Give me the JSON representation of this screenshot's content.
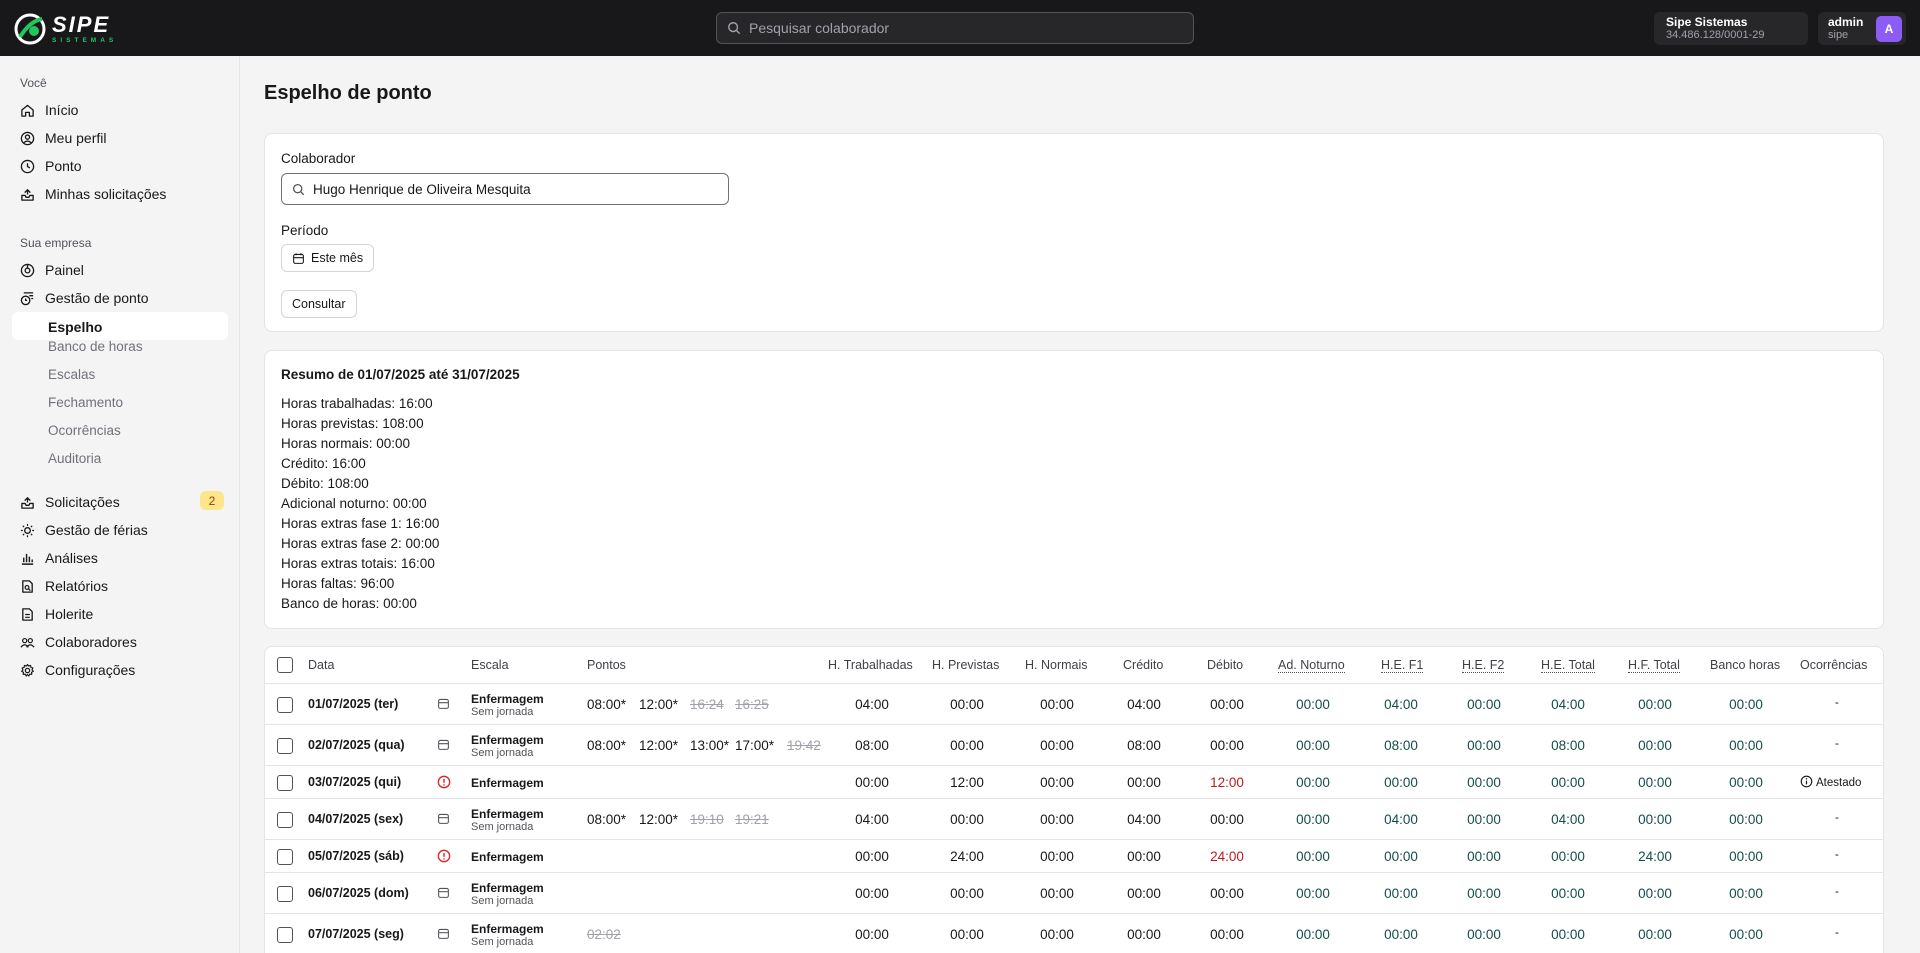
{
  "topbar": {
    "logo_text": "SIPE",
    "logo_sub": "SISTEMAS",
    "search_placeholder": "Pesquisar colaborador",
    "company_name": "Sipe Sistemas",
    "company_cnpj": "34.486.128/0001-29",
    "user_name": "admin",
    "user_sub": "sipe",
    "avatar_letter": "A"
  },
  "sidebar": {
    "section_you": "Você",
    "you_items": [
      {
        "label": "Início",
        "icon": "home-icon"
      },
      {
        "label": "Meu perfil",
        "icon": "user-circle-icon"
      },
      {
        "label": "Ponto",
        "icon": "clock-icon"
      },
      {
        "label": "Minhas solicitações",
        "icon": "inbox-icon"
      }
    ],
    "section_company": "Sua empresa",
    "painel": "Painel",
    "gestao_ponto": "Gestão de ponto",
    "sub_items": [
      "Espelho",
      "Banco de horas",
      "Escalas",
      "Fechamento",
      "Ocorrências",
      "Auditoria"
    ],
    "company_items": [
      {
        "label": "Solicitações",
        "icon": "inbox-icon",
        "badge": "2"
      },
      {
        "label": "Gestão de férias",
        "icon": "sun-icon"
      },
      {
        "label": "Análises",
        "icon": "bar-chart-icon"
      },
      {
        "label": "Relatórios",
        "icon": "report-icon"
      },
      {
        "label": "Holerite",
        "icon": "file-icon"
      },
      {
        "label": "Colaboradores",
        "icon": "users-icon"
      },
      {
        "label": "Configurações",
        "icon": "gear-icon"
      }
    ]
  },
  "page": {
    "title": "Espelho de ponto"
  },
  "filters": {
    "collab_label": "Colaborador",
    "collab_value": "Hugo Henrique de Oliveira Mesquita",
    "period_label": "Período",
    "period_value": "Este mês",
    "submit": "Consultar"
  },
  "summary": {
    "title": "Resumo de 01/07/2025 até 31/07/2025",
    "lines": [
      "Horas trabalhadas: 16:00",
      "Horas previstas: 108:00",
      "Horas normais: 00:00",
      "Crédito: 16:00",
      "Débito: 108:00",
      "Adicional noturno: 00:00",
      "Horas extras fase 1: 16:00",
      "Horas extras fase 2: 00:00",
      "Horas extras totais: 16:00",
      "Horas faltas: 96:00",
      "Banco de horas: 00:00"
    ]
  },
  "table": {
    "headers": {
      "data": "Data",
      "escala": "Escala",
      "pontos": "Pontos",
      "trab": "H. Trabalhadas",
      "prev": "H. Previstas",
      "norm": "H. Normais",
      "cred": "Crédito",
      "deb": "Débito",
      "adn": "Ad. Noturno",
      "he1": "H.E. F1",
      "he2": "H.E. F2",
      "het": "H.E. Total",
      "hft": "H.F. Total",
      "banco": "Banco horas",
      "occ": "Ocorrências"
    },
    "rows": [
      {
        "date": "01/07/2025 (ter)",
        "status": "calendar-icon",
        "escala": "Enfermagem",
        "escala_sub": "Sem jornada",
        "pontos": [
          {
            "t": "08:00*",
            "s": false
          },
          {
            "t": "12:00*",
            "s": false
          },
          {
            "t": "16:24",
            "s": true
          },
          {
            "t": "16:25",
            "s": true
          }
        ],
        "trab": "04:00",
        "prev": "00:00",
        "norm": "00:00",
        "cred": "04:00",
        "deb": "00:00",
        "deb_red": false,
        "adn": "00:00",
        "he1": "04:00",
        "he2": "00:00",
        "het": "04:00",
        "hft": "00:00",
        "banco": "00:00",
        "occ": "-"
      },
      {
        "date": "02/07/2025 (qua)",
        "status": "calendar-icon",
        "escala": "Enfermagem",
        "escala_sub": "Sem jornada",
        "pontos": [
          {
            "t": "08:00*",
            "s": false
          },
          {
            "t": "12:00*",
            "s": false
          },
          {
            "t": "13:00*",
            "s": false
          },
          {
            "t": "17:00*",
            "s": false
          },
          {
            "t": "19:42",
            "s": true
          }
        ],
        "trab": "08:00",
        "prev": "00:00",
        "norm": "00:00",
        "cred": "08:00",
        "deb": "00:00",
        "deb_red": false,
        "adn": "00:00",
        "he1": "08:00",
        "he2": "00:00",
        "het": "08:00",
        "hft": "00:00",
        "banco": "00:00",
        "occ": "-"
      },
      {
        "date": "03/07/2025 (qui)",
        "status": "alert-icon",
        "escala": "Enfermagem",
        "escala_sub": "",
        "pontos": [],
        "trab": "00:00",
        "prev": "12:00",
        "norm": "00:00",
        "cred": "00:00",
        "deb": "12:00",
        "deb_red": true,
        "adn": "00:00",
        "he1": "00:00",
        "he2": "00:00",
        "het": "00:00",
        "hft": "00:00",
        "banco": "00:00",
        "occ": "Atestado",
        "occ_icon": "info-icon"
      },
      {
        "date": "04/07/2025 (sex)",
        "status": "calendar-icon",
        "escala": "Enfermagem",
        "escala_sub": "Sem jornada",
        "pontos": [
          {
            "t": "08:00*",
            "s": false
          },
          {
            "t": "12:00*",
            "s": false
          },
          {
            "t": "19:10",
            "s": true
          },
          {
            "t": "19:21",
            "s": true
          }
        ],
        "trab": "04:00",
        "prev": "00:00",
        "norm": "00:00",
        "cred": "04:00",
        "deb": "00:00",
        "deb_red": false,
        "adn": "00:00",
        "he1": "04:00",
        "he2": "00:00",
        "het": "04:00",
        "hft": "00:00",
        "banco": "00:00",
        "occ": "-"
      },
      {
        "date": "05/07/2025 (sáb)",
        "status": "alert-icon",
        "escala": "Enfermagem",
        "escala_sub": "",
        "pontos": [],
        "trab": "00:00",
        "prev": "24:00",
        "norm": "00:00",
        "cred": "00:00",
        "deb": "24:00",
        "deb_red": true,
        "adn": "00:00",
        "he1": "00:00",
        "he2": "00:00",
        "het": "00:00",
        "hft": "24:00",
        "banco": "00:00",
        "occ": "-"
      },
      {
        "date": "06/07/2025 (dom)",
        "status": "calendar-icon",
        "escala": "Enfermagem",
        "escala_sub": "Sem jornada",
        "pontos": [],
        "trab": "00:00",
        "prev": "00:00",
        "norm": "00:00",
        "cred": "00:00",
        "deb": "00:00",
        "deb_red": false,
        "adn": "00:00",
        "he1": "00:00",
        "he2": "00:00",
        "het": "00:00",
        "hft": "00:00",
        "banco": "00:00",
        "occ": "-"
      },
      {
        "date": "07/07/2025 (seg)",
        "status": "calendar-icon",
        "escala": "Enfermagem",
        "escala_sub": "Sem jornada",
        "pontos": [
          {
            "t": "02:02",
            "s": true
          }
        ],
        "trab": "00:00",
        "prev": "00:00",
        "norm": "00:00",
        "cred": "00:00",
        "deb": "00:00",
        "deb_red": false,
        "adn": "00:00",
        "he1": "00:00",
        "he2": "00:00",
        "het": "00:00",
        "hft": "00:00",
        "banco": "00:00",
        "occ": "-"
      }
    ]
  },
  "colors": {
    "topbar": "#18181b",
    "accent_green": "#22c55e",
    "avatar": "#8b5cf6",
    "value_green": "#134e4a",
    "debit_red": "#b91c1c",
    "badge": "#fde68a"
  }
}
